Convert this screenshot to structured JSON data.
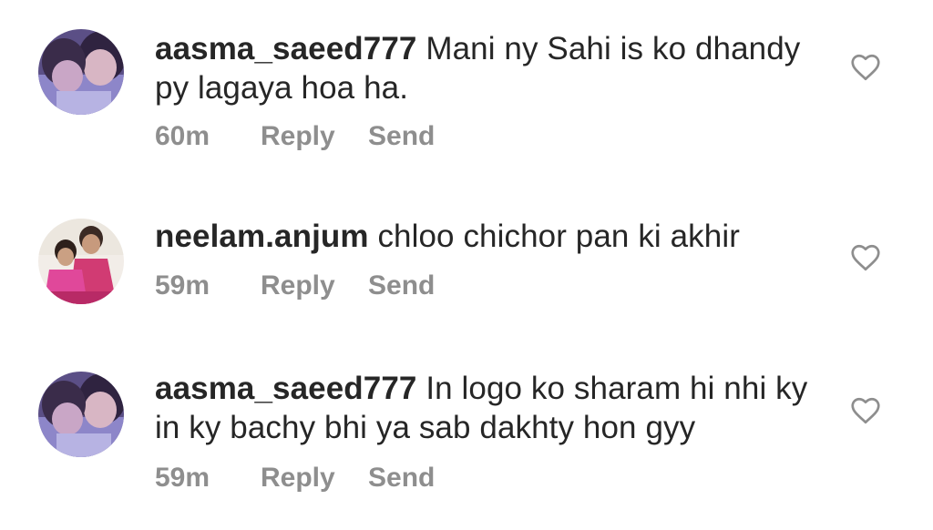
{
  "comments": [
    {
      "username": "aasma_saeed777",
      "text": "Mani ny Sahi is ko dhandy py lagaya hoa ha.",
      "time": "60m",
      "reply_label": "Reply",
      "send_label": "Send",
      "avatar": "child-photo-avatar"
    },
    {
      "username": "neelam.anjum",
      "text": "chloo chichor pan ki akhir",
      "time": "59m",
      "reply_label": "Reply",
      "send_label": "Send",
      "avatar": "girls-photo-avatar"
    },
    {
      "username": "aasma_saeed777",
      "text": "In logo ko sharam hi nhi ky in ky bachy bhi ya sab dakhty hon gyy",
      "time": "59m",
      "reply_label": "Reply",
      "send_label": "Send",
      "avatar": "child-photo-avatar"
    }
  ],
  "icons": {
    "like": "heart-outline-icon"
  },
  "colors": {
    "text": "#262626",
    "meta": "#8e8e8e",
    "background": "#ffffff"
  }
}
